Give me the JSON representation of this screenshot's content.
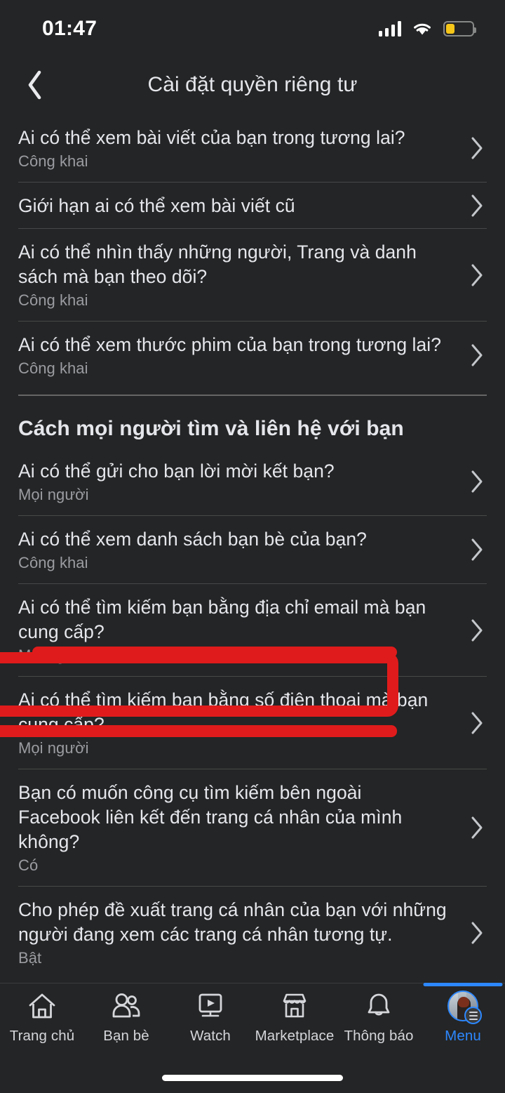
{
  "status_bar": {
    "time": "01:47",
    "icons": [
      "signal-icon",
      "wifi-icon",
      "battery-icon"
    ],
    "battery_level_percent": 32,
    "battery_color": "#f5c518"
  },
  "header": {
    "back_icon": "chevron-left-icon",
    "title": "Cài đặt quyền riêng tư"
  },
  "theme": {
    "background": "#242526",
    "primary_text": "#e4e6eb",
    "secondary_text": "#9a9ca1",
    "accent": "#2d88ff",
    "annotation": "#e01b1b"
  },
  "list": {
    "rows": [
      {
        "title": "Ai có thể xem bài viết của bạn trong tương lai?",
        "value": "Công khai",
        "chevron": "chevron-right-icon"
      },
      {
        "title": "Giới hạn ai có thể xem bài viết cũ",
        "value": "",
        "chevron": "chevron-right-icon"
      },
      {
        "title": "Ai có thể nhìn thấy những người, Trang và danh sách mà bạn theo dõi?",
        "value": "Công khai",
        "chevron": "chevron-right-icon"
      },
      {
        "title": "Ai có thể xem thước phim của bạn trong tương lai?",
        "value": "Công khai",
        "chevron": "chevron-right-icon"
      }
    ]
  },
  "section": {
    "heading": "Cách mọi người tìm và liên hệ với bạn",
    "rows": [
      {
        "title": "Ai có thể gửi cho bạn lời mời kết bạn?",
        "value": "Mọi người",
        "chevron": "chevron-right-icon",
        "highlighted": false
      },
      {
        "title": "Ai có thể xem danh sách bạn bè của bạn?",
        "value": "Công khai",
        "chevron": "chevron-right-icon",
        "highlighted": true
      },
      {
        "title": "Ai có thể tìm kiếm bạn bằng địa chỉ email mà bạn cung cấp?",
        "value": "Mọi người",
        "chevron": "chevron-right-icon",
        "highlighted": false
      },
      {
        "title": "Ai có thể tìm kiếm bạn bằng số điện thoại mà bạn cung cấp?",
        "value": "Mọi người",
        "chevron": "chevron-right-icon",
        "highlighted": false
      },
      {
        "title": "Bạn có muốn công cụ tìm kiếm bên ngoài Facebook liên kết đến trang cá nhân của mình không?",
        "value": "Có",
        "chevron": "chevron-right-icon",
        "highlighted": false
      },
      {
        "title": "Cho phép đề xuất trang cá nhân của bạn với những người đang xem các trang cá nhân tương tự.",
        "value": "Bật",
        "chevron": "chevron-right-icon",
        "highlighted": false
      }
    ]
  },
  "bottom_nav": {
    "items": [
      {
        "label": "Trang chủ",
        "icon": "home-icon",
        "active": false
      },
      {
        "label": "Bạn bè",
        "icon": "friends-icon",
        "active": false
      },
      {
        "label": "Watch",
        "icon": "watch-play-icon",
        "active": false
      },
      {
        "label": "Marketplace",
        "icon": "marketplace-store-icon",
        "active": false
      },
      {
        "label": "Thông báo",
        "icon": "bell-icon",
        "active": false
      },
      {
        "label": "Menu",
        "icon": "profile-avatar-hamburger-icon",
        "active": true
      }
    ]
  }
}
